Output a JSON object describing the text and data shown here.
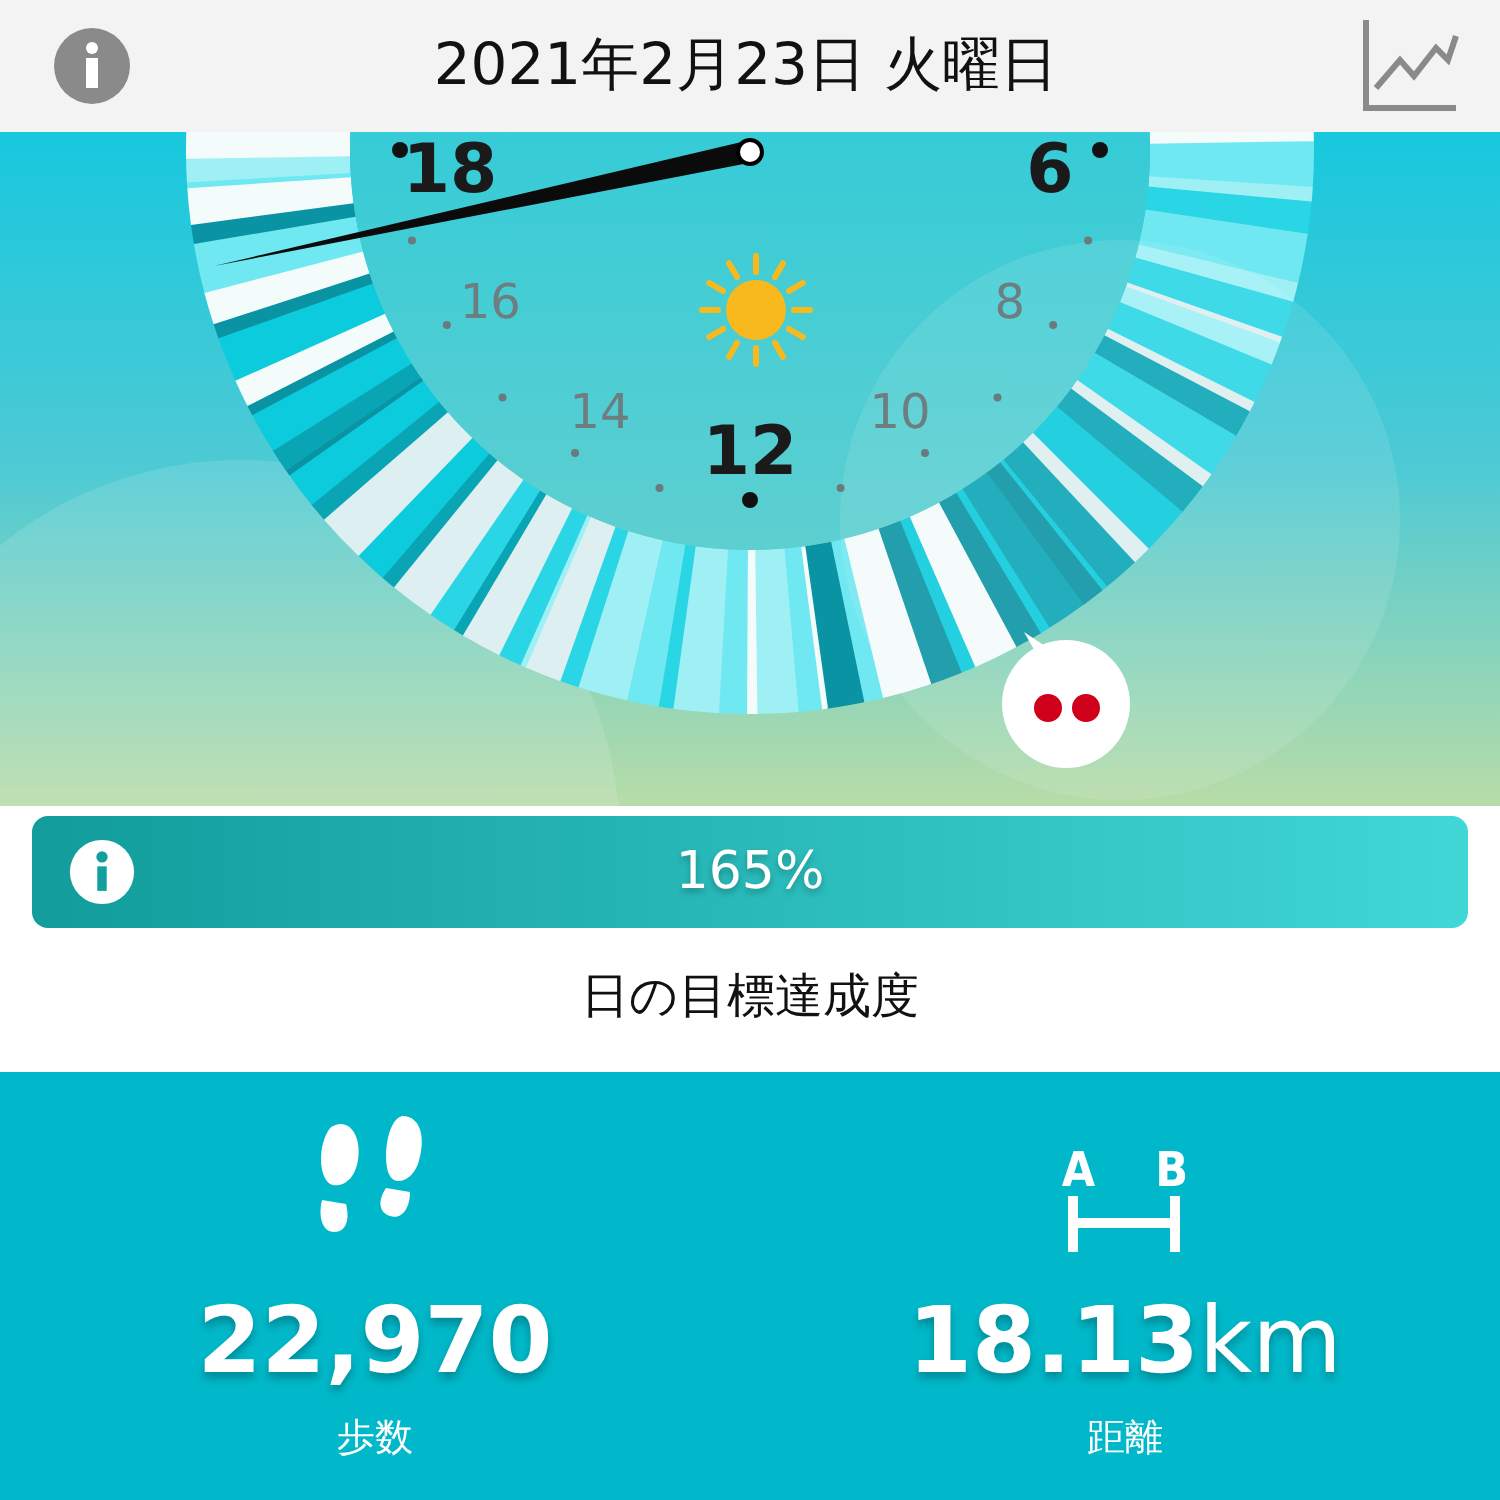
{
  "header": {
    "title": "2021年2月23日 火曜日"
  },
  "dial": {
    "hour_labels": [
      {
        "text": "18",
        "kind": "major"
      },
      {
        "text": "6",
        "kind": "major"
      },
      {
        "text": "16",
        "kind": "minor"
      },
      {
        "text": "8",
        "kind": "minor"
      },
      {
        "text": "14",
        "kind": "minor"
      },
      {
        "text": "10",
        "kind": "minor"
      },
      {
        "text": "12",
        "kind": "major"
      }
    ]
  },
  "goal": {
    "percent": "165%",
    "label": "日の目標達成度"
  },
  "stats": [
    {
      "kind": "steps",
      "value": "22,970",
      "label": "歩数"
    },
    {
      "kind": "distance",
      "value": "18.13",
      "unit": "km",
      "label": "距離",
      "endpoints": [
        "A",
        "B"
      ]
    }
  ]
}
